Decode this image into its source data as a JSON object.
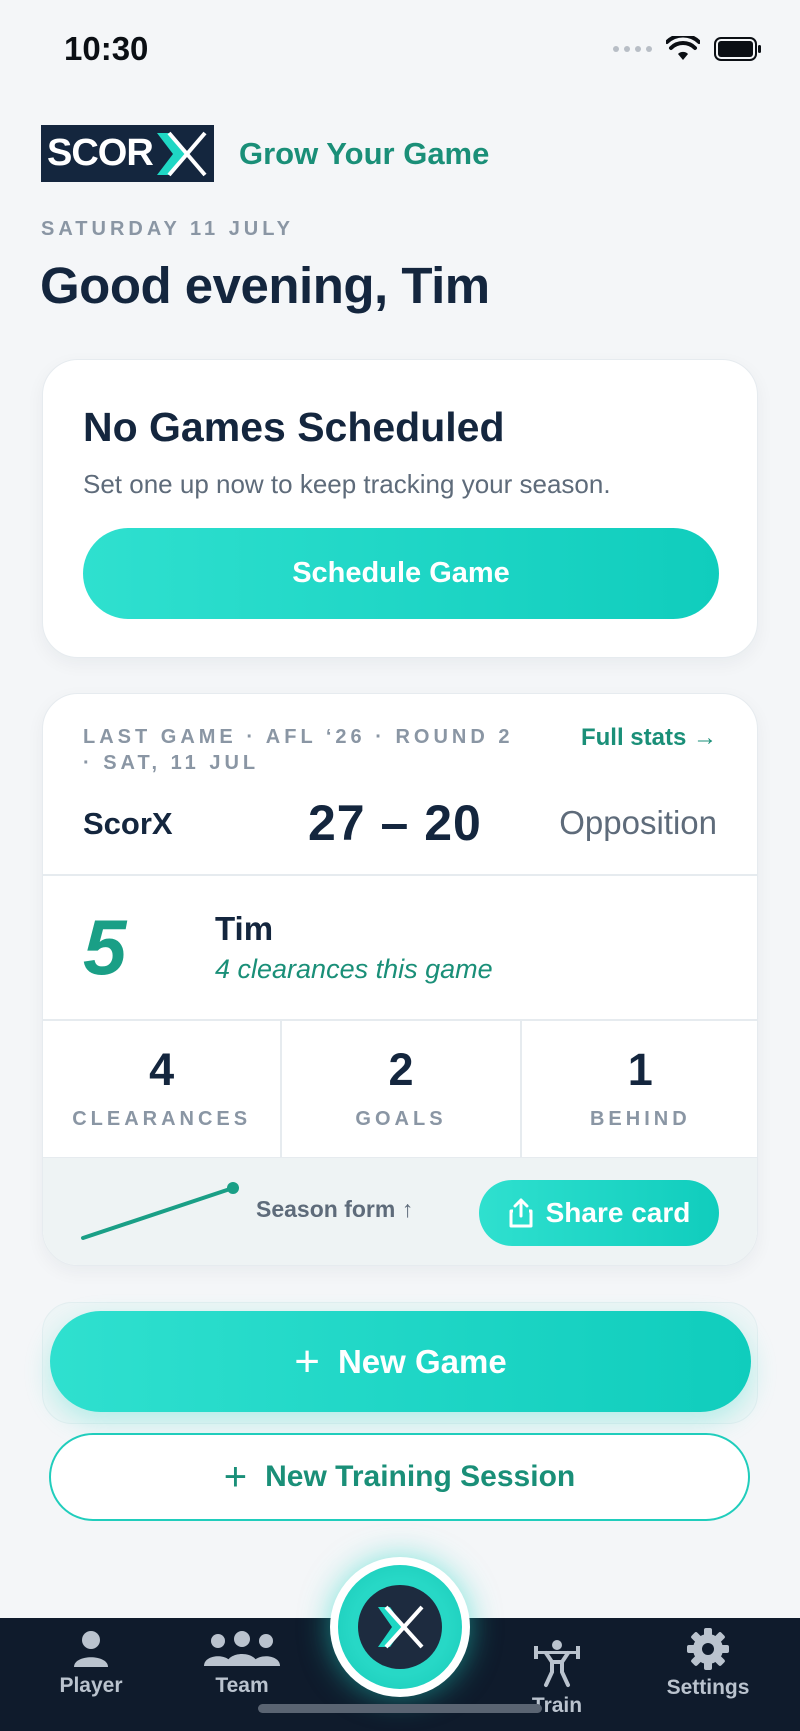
{
  "status_bar": {
    "time": "10:30"
  },
  "brand": {
    "logo_text": "SCOR",
    "tagline": "Grow Your Game"
  },
  "header": {
    "date": "SATURDAY 11 JULY",
    "greeting": "Good evening, Tim"
  },
  "no_games_card": {
    "title": "No Games Scheduled",
    "subtitle": "Set one up now to keep tracking your season.",
    "button_label": "Schedule Game"
  },
  "last_game": {
    "meta": "LAST GAME · AFL ‘26 · ROUND 2 · SAT, 11 JUL",
    "full_stats_label": "Full stats →",
    "team": "ScorX",
    "score": "27 – 20",
    "opponent": "Opposition",
    "player": {
      "number": "5",
      "name": "Tim",
      "note": "4 clearances this game"
    },
    "stats": [
      {
        "value": "4",
        "label": "CLEARANCES"
      },
      {
        "value": "2",
        "label": "GOALS"
      },
      {
        "value": "1",
        "label": "BEHIND"
      }
    ],
    "form_label": "Season form ↑",
    "share_label": "Share card"
  },
  "actions": {
    "new_game": "New Game",
    "new_training": "New Training Session",
    "plus": "+"
  },
  "tabbar": {
    "items": [
      {
        "label": "Player",
        "icon": "person-icon"
      },
      {
        "label": "Team",
        "icon": "group-icon"
      },
      {
        "label": "",
        "icon": "scorx-logo-icon"
      },
      {
        "label": "Train",
        "icon": "weightlifter-icon"
      },
      {
        "label": "Settings",
        "icon": "gear-icon"
      }
    ]
  },
  "colors": {
    "accent": "#1fd7c4",
    "brand_green": "#1a8f78",
    "navy": "#14263e",
    "tabbar": "#0f1b2c"
  }
}
